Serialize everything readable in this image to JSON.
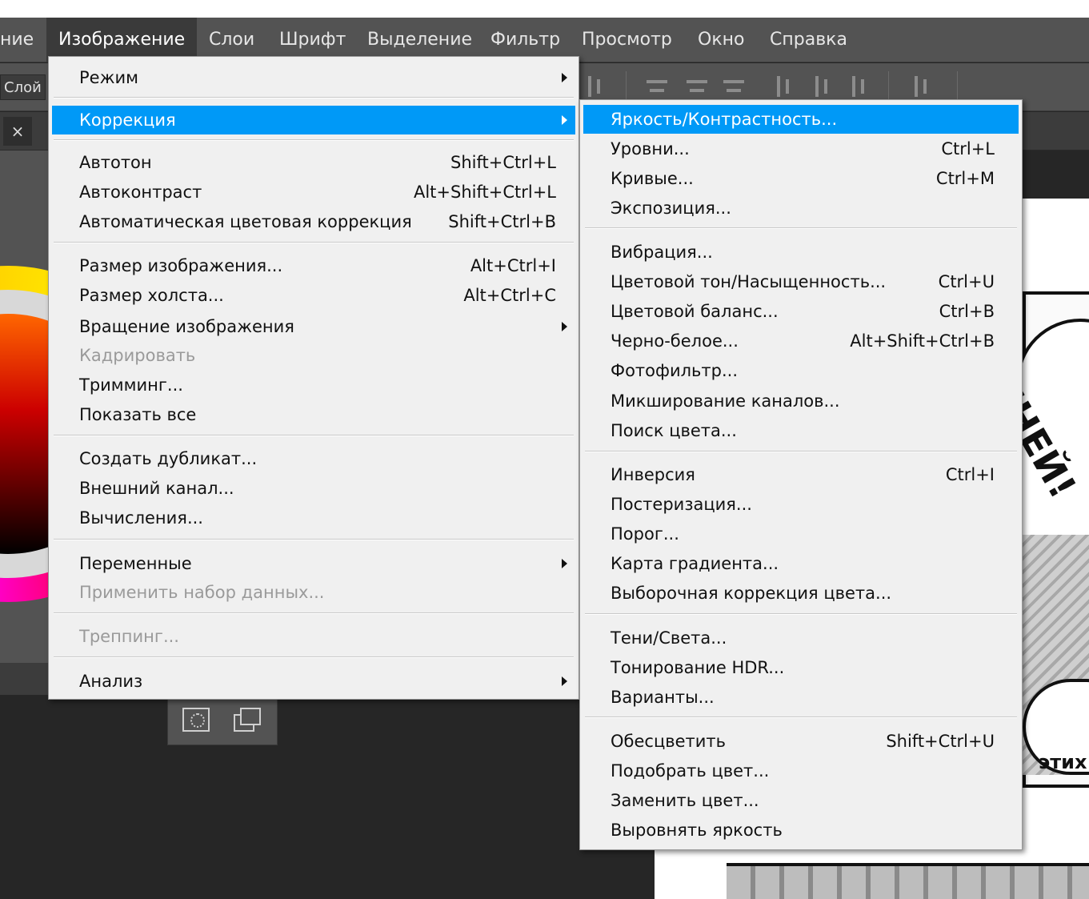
{
  "menubar": {
    "items": [
      {
        "label": "ние"
      },
      {
        "label": "Изображение"
      },
      {
        "label": "Слои"
      },
      {
        "label": "Шрифт"
      },
      {
        "label": "Выделение"
      },
      {
        "label": "Фильтр"
      },
      {
        "label": "Просмотр"
      },
      {
        "label": "Окно"
      },
      {
        "label": "Справка"
      }
    ]
  },
  "options_bar": {
    "layer_label": "Слой"
  },
  "tabs": {
    "close_glyph": "×"
  },
  "canvas": {
    "text_top": "АПНЕЙ!",
    "text_bottom": "этих"
  },
  "image_menu": {
    "items": [
      {
        "label": "Режим",
        "shortcut": "",
        "submenu": true
      },
      {
        "label": "Коррекция",
        "shortcut": "",
        "submenu": true,
        "highlighted": true
      },
      {
        "label": "Автотон",
        "shortcut": "Shift+Ctrl+L"
      },
      {
        "label": "Автоконтраст",
        "shortcut": "Alt+Shift+Ctrl+L"
      },
      {
        "label": "Автоматическая цветовая коррекция",
        "shortcut": "Shift+Ctrl+B"
      },
      {
        "label": "Размер изображения...",
        "shortcut": "Alt+Ctrl+I"
      },
      {
        "label": "Размер холста...",
        "shortcut": "Alt+Ctrl+C"
      },
      {
        "label": "Вращение изображения",
        "shortcut": "",
        "submenu": true
      },
      {
        "label": "Кадрировать",
        "shortcut": "",
        "disabled": true
      },
      {
        "label": "Тримминг...",
        "shortcut": ""
      },
      {
        "label": "Показать все",
        "shortcut": ""
      },
      {
        "label": "Создать дубликат...",
        "shortcut": ""
      },
      {
        "label": "Внешний канал...",
        "shortcut": ""
      },
      {
        "label": "Вычисления...",
        "shortcut": ""
      },
      {
        "label": "Переменные",
        "shortcut": "",
        "submenu": true
      },
      {
        "label": "Применить набор данных...",
        "shortcut": "",
        "disabled": true
      },
      {
        "label": "Треппинг...",
        "shortcut": "",
        "disabled": true
      },
      {
        "label": "Анализ",
        "shortcut": "",
        "submenu": true
      }
    ]
  },
  "correction_menu": {
    "items": [
      {
        "label": "Яркость/Контрастность...",
        "shortcut": "",
        "highlighted": true
      },
      {
        "label": "Уровни...",
        "shortcut": "Ctrl+L"
      },
      {
        "label": "Кривые...",
        "shortcut": "Ctrl+M"
      },
      {
        "label": "Экспозиция...",
        "shortcut": ""
      },
      {
        "label": "Вибрация...",
        "shortcut": ""
      },
      {
        "label": "Цветовой тон/Насыщенность...",
        "shortcut": "Ctrl+U"
      },
      {
        "label": "Цветовой баланс...",
        "shortcut": "Ctrl+B"
      },
      {
        "label": "Черно-белое...",
        "shortcut": "Alt+Shift+Ctrl+B"
      },
      {
        "label": "Фотофильтр...",
        "shortcut": ""
      },
      {
        "label": "Микширование каналов...",
        "shortcut": ""
      },
      {
        "label": "Поиск цвета...",
        "shortcut": ""
      },
      {
        "label": "Инверсия",
        "shortcut": "Ctrl+I"
      },
      {
        "label": "Постеризация...",
        "shortcut": ""
      },
      {
        "label": "Порог...",
        "shortcut": ""
      },
      {
        "label": "Карта градиента...",
        "shortcut": ""
      },
      {
        "label": "Выборочная коррекция цвета...",
        "shortcut": ""
      },
      {
        "label": "Тени/Света...",
        "shortcut": ""
      },
      {
        "label": "Тонирование HDR...",
        "shortcut": ""
      },
      {
        "label": "Варианты...",
        "shortcut": ""
      },
      {
        "label": "Обесцветить",
        "shortcut": "Shift+Ctrl+U"
      },
      {
        "label": "Подобрать цвет...",
        "shortcut": ""
      },
      {
        "label": "Заменить цвет...",
        "shortcut": ""
      },
      {
        "label": "Выровнять яркость",
        "shortcut": ""
      }
    ]
  },
  "colors": {
    "menu_bg": "#f0f0f0",
    "highlight": "#0099f7",
    "app_bg": "#262626",
    "menubar_bg": "#535353",
    "disabled_text": "#9a9a9a"
  }
}
